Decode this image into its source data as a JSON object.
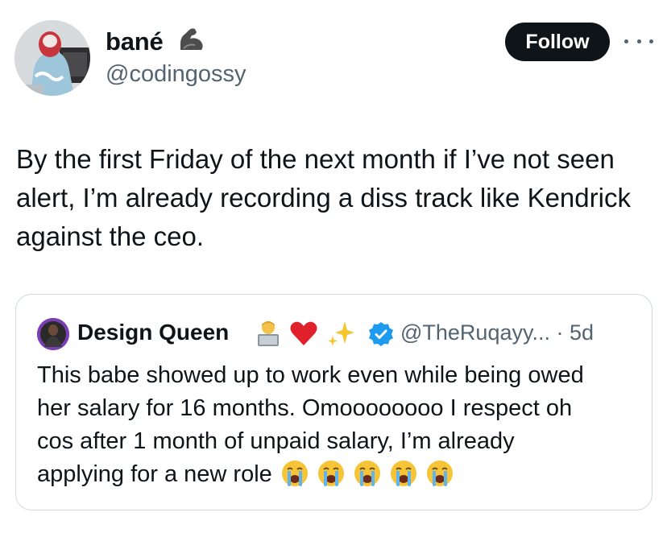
{
  "author": {
    "display_name": "bané",
    "name_emoji": "flexed-biceps-icon",
    "handle": "@codingossy"
  },
  "actions": {
    "follow_label": "Follow",
    "more_icon": "more-icon"
  },
  "tweet": {
    "text": "By the first Friday of the next month if I’ve not seen alert, I’m already recording a diss track like Kendrick against the ceo."
  },
  "quoted_tweet": {
    "display_name": "Design Queen",
    "name_emojis": [
      "technologist-icon",
      "red-heart-icon",
      "sparkles-icon"
    ],
    "verified": true,
    "handle_time": "@TheRuqayy... · 5d",
    "text": "This babe showed up to work even while being owed her salary for 16 months. Omoooooooo I respect oh cos after 1 month of unpaid salary, I’m already applying for a new role",
    "trailing_emojis": [
      "crying-face-icon",
      "crying-face-icon",
      "crying-face-icon",
      "crying-face-icon",
      "crying-face-icon"
    ]
  },
  "colors": {
    "text_primary": "#0f1419",
    "text_secondary": "#536471",
    "verified_blue": "#1d9bf0",
    "border": "#cfd9de",
    "follow_bg": "#0f1419"
  }
}
